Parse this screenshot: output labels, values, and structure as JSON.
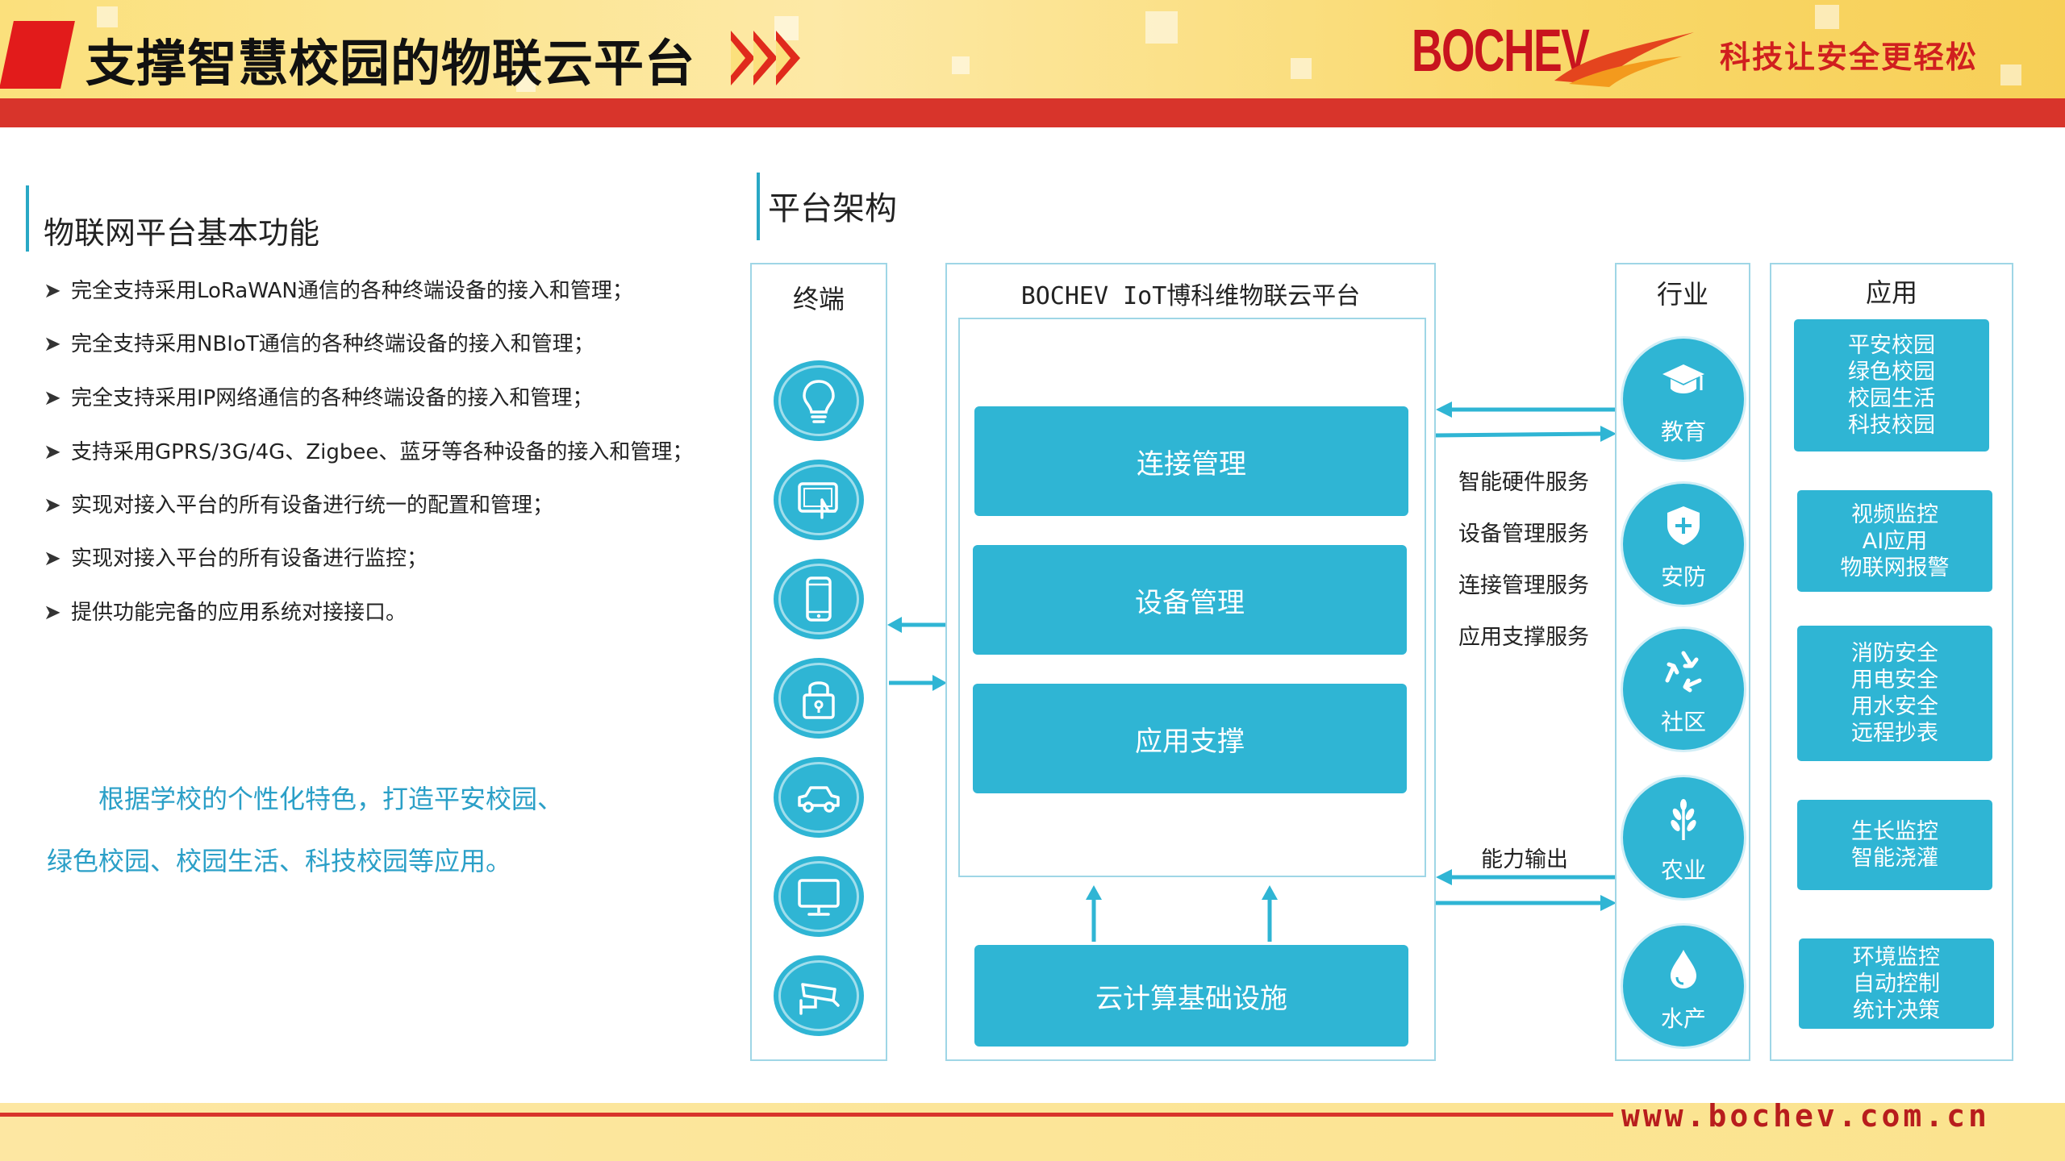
{
  "header": {
    "title": "支撑智慧校园的物联云平台",
    "logo_text": "BOCHEV",
    "slogan": "科技让安全更轻松",
    "accent_red": "#d8342b",
    "brand_red": "#c8141e"
  },
  "footer": {
    "url": "www.bochev.com.cn"
  },
  "left": {
    "heading": "物联网平台基本功能",
    "bullets": [
      "完全支持采用LoRaWAN通信的各种终端设备的接入和管理；",
      "完全支持采用NBIoT通信的各种终端设备的接入和管理；",
      "完全支持采用IP网络通信的各种终端设备的接入和管理；",
      "支持采用GPRS/3G/4G、Zigbee、蓝牙等各种设备的接入和管理；",
      "实现对接入平台的所有设备进行统一的配置和管理；",
      "实现对接入平台的所有设备进行监控；",
      "提供功能完备的应用系统对接接口。"
    ],
    "paragraph_line1": "根据学校的个性化特色，打造平安校园、",
    "paragraph_line2": "绿色校园、校园生活、科技校园等应用。",
    "text_accent": "#2a9fc7"
  },
  "diagram": {
    "heading": "平台架构",
    "primary_color": "#2fb5d4",
    "terminals": {
      "title": "终端",
      "icons": [
        "lightbulb-icon",
        "touch-screen-icon",
        "mobile-phone-icon",
        "padlock-icon",
        "car-icon",
        "monitor-icon",
        "cctv-camera-icon"
      ]
    },
    "platform": {
      "title": "BOCHEV IoT博科维物联云平台",
      "modules": [
        "连接管理",
        "设备管理",
        "应用支撑"
      ],
      "infrastructure": "云计算基础设施"
    },
    "services": [
      "智能硬件服务",
      "设备管理服务",
      "连接管理服务",
      "应用支撑服务"
    ],
    "output_label": "能力输出",
    "industries": {
      "title": "行业",
      "items": [
        {
          "label": "教育",
          "icon": "graduation-cap-icon"
        },
        {
          "label": "安防",
          "icon": "shield-icon"
        },
        {
          "label": "社区",
          "icon": "recycle-icon"
        },
        {
          "label": "农业",
          "icon": "wheat-icon"
        },
        {
          "label": "水产",
          "icon": "water-drop-icon"
        }
      ]
    },
    "applications": {
      "title": "应用",
      "groups": [
        [
          "平安校园",
          "绿色校园",
          "校园生活",
          "科技校园"
        ],
        [
          "视频监控",
          "AI应用",
          "物联网报警"
        ],
        [
          "消防安全",
          "用电安全",
          "用水安全",
          "远程抄表"
        ],
        [
          "生长监控",
          "智能浇灌"
        ],
        [
          "环境监控",
          "自动控制",
          "统计决策"
        ]
      ]
    }
  }
}
